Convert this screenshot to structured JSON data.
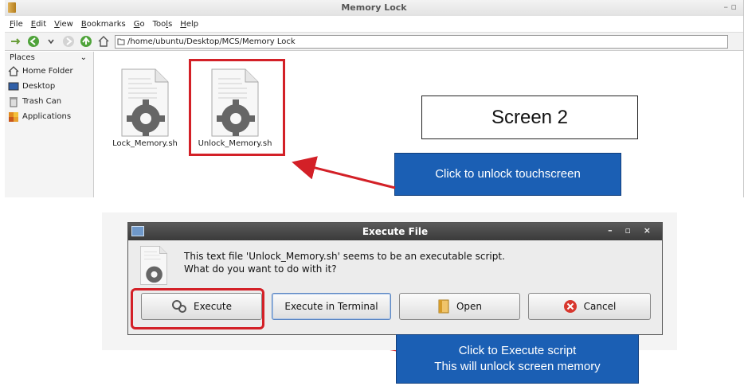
{
  "file_manager": {
    "title": "Memory Lock",
    "menu": [
      "File",
      "Edit",
      "View",
      "Bookmarks",
      "Go",
      "Tools",
      "Help"
    ],
    "path": "/home/ubuntu/Desktop/MCS/Memory Lock",
    "sidebar": {
      "header": "Places",
      "items": [
        "Home Folder",
        "Desktop",
        "Trash Can",
        "Applications"
      ]
    },
    "files": [
      {
        "name": "Lock_Memory.sh"
      },
      {
        "name": "Unlock_Memory.sh"
      }
    ]
  },
  "annotations": {
    "screen_label": "Screen 2",
    "callout_unlock": "Click to unlock touchscreen",
    "callout_execute_line1": "Click to Execute script",
    "callout_execute_line2": "This will unlock screen memory",
    "highlight_color": "#d32027",
    "callout_color": "#1b5fb4"
  },
  "dialog": {
    "title": "Execute File",
    "message_line1": "This text file 'Unlock_Memory.sh' seems to be an executable script.",
    "message_line2": "What do you want to do with it?",
    "buttons": {
      "execute": "Execute",
      "execute_terminal": "Execute in Terminal",
      "open": "Open",
      "cancel": "Cancel"
    }
  }
}
